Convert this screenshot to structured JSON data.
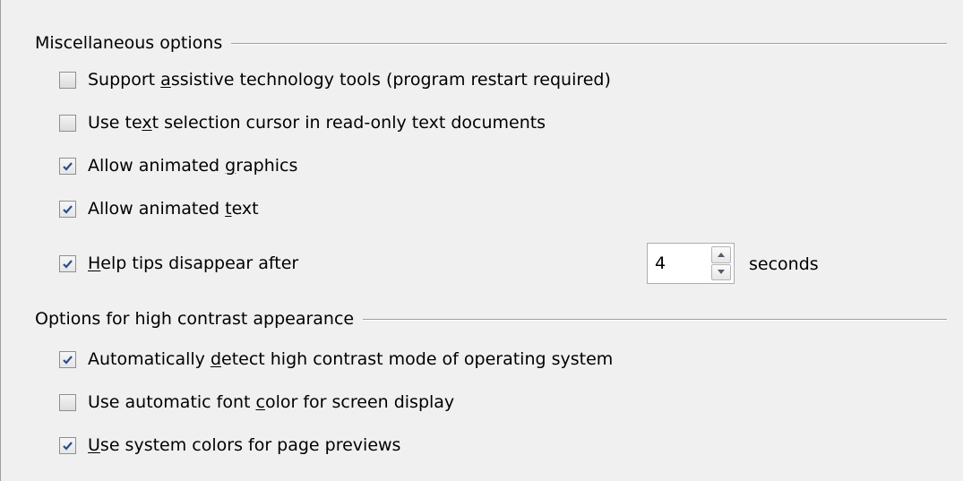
{
  "sections": [
    {
      "title": "Miscellaneous options",
      "options": [
        {
          "pre": "Support ",
          "acc": "a",
          "post": "ssistive technology tools (program restart required)",
          "checked": false
        },
        {
          "pre": "Use te",
          "acc": "x",
          "post": "t selection cursor in read-only text documents",
          "checked": false
        },
        {
          "pre": "Allow animated ",
          "acc": "g",
          "post": "raphics",
          "checked": true
        },
        {
          "pre": "Allow animated ",
          "acc": "t",
          "post": "ext",
          "checked": true
        },
        {
          "pre": "",
          "acc": "H",
          "post": "elp tips disappear after",
          "checked": true
        }
      ]
    },
    {
      "title": "Options for high contrast appearance",
      "options": [
        {
          "pre": "Automatically ",
          "acc": "d",
          "post": "etect high contrast mode of operating system",
          "checked": true
        },
        {
          "pre": "Use automatic font ",
          "acc": "c",
          "post": "olor for screen display",
          "checked": false
        },
        {
          "pre": "",
          "acc": "U",
          "post": "se system colors for page previews",
          "checked": true
        }
      ]
    }
  ],
  "help_tips": {
    "value": "4",
    "unit": "seconds"
  },
  "icons": {
    "check": "checkmark-icon",
    "spin_up": "spin-up-arrow-icon",
    "spin_down": "spin-down-arrow-icon"
  },
  "colors": {
    "background": "#f0f0f0",
    "check_mark": "#2a4c8e",
    "border": "#8e8f8f"
  }
}
